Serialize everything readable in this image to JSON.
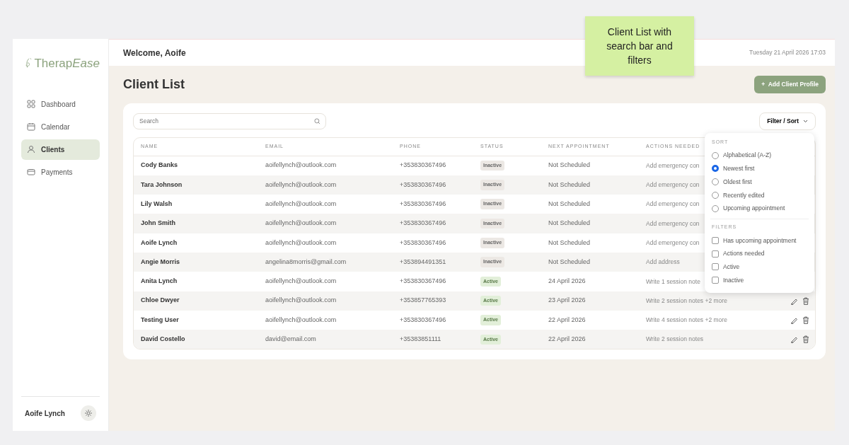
{
  "annotation": "Client List with search bar and filters",
  "sidebar": {
    "logo_main": "Therap",
    "logo_accent": "Ease",
    "items": [
      {
        "label": "Dashboard",
        "selected": false
      },
      {
        "label": "Calendar",
        "selected": false
      },
      {
        "label": "Clients",
        "selected": true
      },
      {
        "label": "Payments",
        "selected": false
      }
    ],
    "user": "Aoife Lynch"
  },
  "header": {
    "welcome": "Welcome, Aoife",
    "datetime": "Tuesday 21 April 2026 17:03"
  },
  "page_title": "Client List",
  "add_button": {
    "icon": "+",
    "label": "Add Client Profile"
  },
  "search": {
    "placeholder": "Search"
  },
  "filter_button": "Filter / Sort",
  "table": {
    "columns": [
      "NAME",
      "EMAIL",
      "PHONE",
      "STATUS",
      "NEXT APPOINTMENT",
      "ACTIONS NEEDED"
    ],
    "rows": [
      {
        "name": "Cody Banks",
        "email": "aoifellynch@outlook.com",
        "phone": "+353830367496",
        "status": "Inactive",
        "active": false,
        "next": "Not Scheduled",
        "actions": "Add emergency con"
      },
      {
        "name": "Tara Johnson",
        "email": "aoifellynch@outlook.com",
        "phone": "+353830367496",
        "status": "Inactive",
        "active": false,
        "next": "Not Scheduled",
        "actions": "Add emergency con"
      },
      {
        "name": "Lily Walsh",
        "email": "aoifellynch@outlook.com",
        "phone": "+353830367496",
        "status": "Inactive",
        "active": false,
        "next": "Not Scheduled",
        "actions": "Add emergency con"
      },
      {
        "name": "John Smith",
        "email": "aoifellynch@outlook.com",
        "phone": "+353830367496",
        "status": "Inactive",
        "active": false,
        "next": "Not Scheduled",
        "actions": "Add emergency con"
      },
      {
        "name": "Aoife Lynch",
        "email": "aoifellynch@outlook.com",
        "phone": "+353830367496",
        "status": "Inactive",
        "active": false,
        "next": "Not Scheduled",
        "actions": "Add emergency con"
      },
      {
        "name": "Angie Morris",
        "email": "angelina8morris@gmail.com",
        "phone": "+353894491351",
        "status": "Inactive",
        "active": false,
        "next": "Not Scheduled",
        "actions": "Add address"
      },
      {
        "name": "Anita Lynch",
        "email": "aoifellynch@outlook.com",
        "phone": "+353830367496",
        "status": "Active",
        "active": true,
        "next": "24 April 2026",
        "actions": "Write 1 session note"
      },
      {
        "name": "Chloe Dwyer",
        "email": "aoifellynch@outlook.com",
        "phone": "+353857765393",
        "status": "Active",
        "active": true,
        "next": "23 April 2026",
        "actions": "Write 2 session notes +2 more",
        "icons_visible": true
      },
      {
        "name": "Testing User",
        "email": "aoifellynch@outlook.com",
        "phone": "+353830367496",
        "status": "Active",
        "active": true,
        "next": "22 April 2026",
        "actions": "Write 4 session notes +2 more",
        "icons_visible": true
      },
      {
        "name": "David Costello",
        "email": "david@email.com",
        "phone": "+35383851111",
        "status": "Active",
        "active": true,
        "next": "22 April 2026",
        "actions": "Write 2 session notes",
        "icons_visible": true
      }
    ]
  },
  "dropdown": {
    "sort_heading": "SORT",
    "sort_options": [
      {
        "label": "Alphabetical (A-Z)",
        "selected": false
      },
      {
        "label": "Newest first",
        "selected": true
      },
      {
        "label": "Oldest first",
        "selected": false
      },
      {
        "label": "Recently edited",
        "selected": false
      },
      {
        "label": "Upcoming appointment",
        "selected": false
      }
    ],
    "filters_heading": "FILTERS",
    "filters": [
      {
        "label": "Has upcoming appointment",
        "checked": false
      },
      {
        "label": "Actions needed",
        "checked": false
      },
      {
        "label": "Active",
        "checked": false
      },
      {
        "label": "Inactive",
        "checked": false
      }
    ]
  }
}
